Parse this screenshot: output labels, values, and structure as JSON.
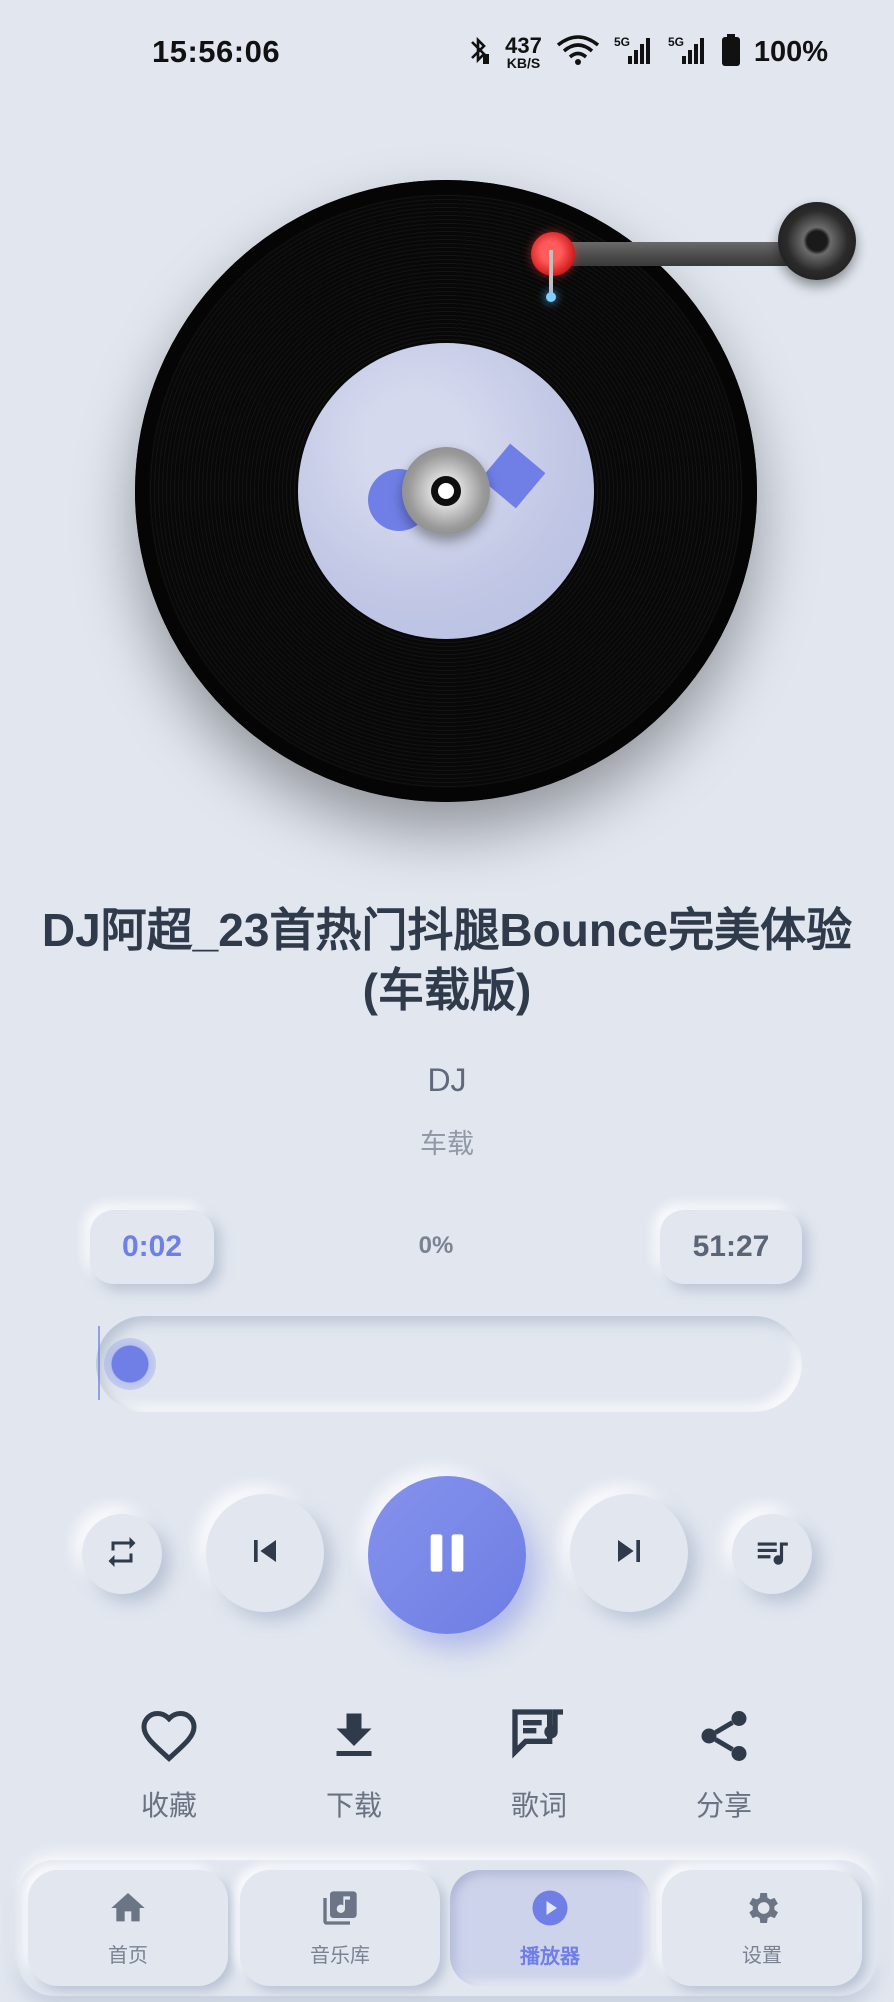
{
  "status_bar": {
    "time": "15:56:06",
    "net_speed_value": "437",
    "net_speed_unit": "KB/S",
    "network_1": "5G",
    "network_2": "5G",
    "battery": "100%"
  },
  "player": {
    "title": "DJ阿超_23首热门抖腿Bounce完美体验(车载版)",
    "artist": "DJ",
    "album": "车载",
    "current_time": "0:02",
    "total_time": "51:27",
    "progress_percent_label": "0%",
    "progress_fraction": 0.0
  },
  "controls": {
    "repeat_icon": "repeat-icon",
    "prev_icon": "skip-previous-icon",
    "play_state_icon": "pause-icon",
    "next_icon": "skip-next-icon",
    "queue_icon": "queue-music-icon"
  },
  "actions": [
    {
      "label": "收藏",
      "icon": "heart-icon"
    },
    {
      "label": "下载",
      "icon": "download-icon"
    },
    {
      "label": "歌词",
      "icon": "lyrics-icon"
    },
    {
      "label": "分享",
      "icon": "share-icon"
    }
  ],
  "bottom_nav": [
    {
      "label": "首页",
      "icon": "home-icon"
    },
    {
      "label": "音乐库",
      "icon": "library-music-icon"
    },
    {
      "label": "播放器",
      "icon": "play-circle-icon",
      "active": true
    },
    {
      "label": "设置",
      "icon": "settings-icon"
    }
  ],
  "colors": {
    "accent": "#6f7fe6",
    "background": "#e1e6ef",
    "text": "#2f3a4b"
  }
}
